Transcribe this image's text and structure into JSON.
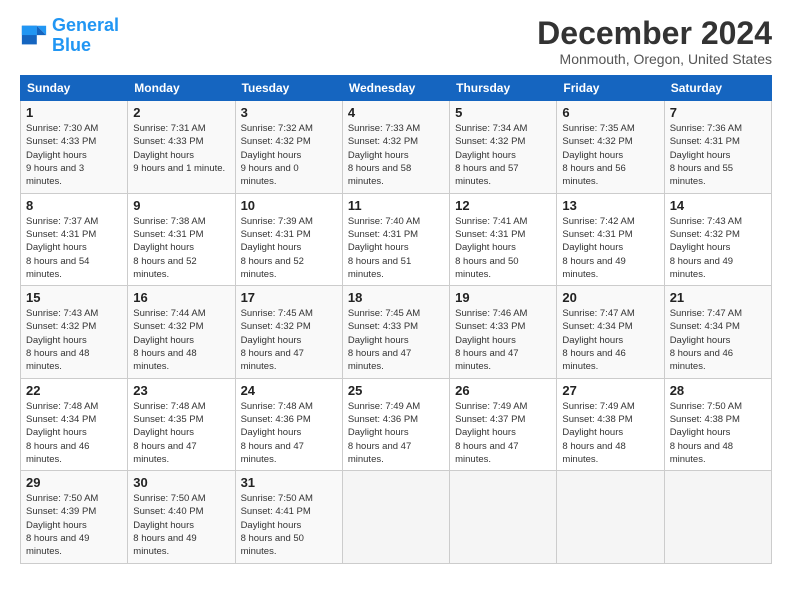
{
  "header": {
    "logo_line1": "General",
    "logo_line2": "Blue",
    "title": "December 2024",
    "subtitle": "Monmouth, Oregon, United States"
  },
  "days_of_week": [
    "Sunday",
    "Monday",
    "Tuesday",
    "Wednesday",
    "Thursday",
    "Friday",
    "Saturday"
  ],
  "weeks": [
    [
      {
        "num": "1",
        "rise": "7:30 AM",
        "set": "4:33 PM",
        "daylight": "9 hours and 3 minutes."
      },
      {
        "num": "2",
        "rise": "7:31 AM",
        "set": "4:33 PM",
        "daylight": "9 hours and 1 minute."
      },
      {
        "num": "3",
        "rise": "7:32 AM",
        "set": "4:32 PM",
        "daylight": "9 hours and 0 minutes."
      },
      {
        "num": "4",
        "rise": "7:33 AM",
        "set": "4:32 PM",
        "daylight": "8 hours and 58 minutes."
      },
      {
        "num": "5",
        "rise": "7:34 AM",
        "set": "4:32 PM",
        "daylight": "8 hours and 57 minutes."
      },
      {
        "num": "6",
        "rise": "7:35 AM",
        "set": "4:32 PM",
        "daylight": "8 hours and 56 minutes."
      },
      {
        "num": "7",
        "rise": "7:36 AM",
        "set": "4:31 PM",
        "daylight": "8 hours and 55 minutes."
      }
    ],
    [
      {
        "num": "8",
        "rise": "7:37 AM",
        "set": "4:31 PM",
        "daylight": "8 hours and 54 minutes."
      },
      {
        "num": "9",
        "rise": "7:38 AM",
        "set": "4:31 PM",
        "daylight": "8 hours and 52 minutes."
      },
      {
        "num": "10",
        "rise": "7:39 AM",
        "set": "4:31 PM",
        "daylight": "8 hours and 52 minutes."
      },
      {
        "num": "11",
        "rise": "7:40 AM",
        "set": "4:31 PM",
        "daylight": "8 hours and 51 minutes."
      },
      {
        "num": "12",
        "rise": "7:41 AM",
        "set": "4:31 PM",
        "daylight": "8 hours and 50 minutes."
      },
      {
        "num": "13",
        "rise": "7:42 AM",
        "set": "4:31 PM",
        "daylight": "8 hours and 49 minutes."
      },
      {
        "num": "14",
        "rise": "7:43 AM",
        "set": "4:32 PM",
        "daylight": "8 hours and 49 minutes."
      }
    ],
    [
      {
        "num": "15",
        "rise": "7:43 AM",
        "set": "4:32 PM",
        "daylight": "8 hours and 48 minutes."
      },
      {
        "num": "16",
        "rise": "7:44 AM",
        "set": "4:32 PM",
        "daylight": "8 hours and 48 minutes."
      },
      {
        "num": "17",
        "rise": "7:45 AM",
        "set": "4:32 PM",
        "daylight": "8 hours and 47 minutes."
      },
      {
        "num": "18",
        "rise": "7:45 AM",
        "set": "4:33 PM",
        "daylight": "8 hours and 47 minutes."
      },
      {
        "num": "19",
        "rise": "7:46 AM",
        "set": "4:33 PM",
        "daylight": "8 hours and 47 minutes."
      },
      {
        "num": "20",
        "rise": "7:47 AM",
        "set": "4:34 PM",
        "daylight": "8 hours and 46 minutes."
      },
      {
        "num": "21",
        "rise": "7:47 AM",
        "set": "4:34 PM",
        "daylight": "8 hours and 46 minutes."
      }
    ],
    [
      {
        "num": "22",
        "rise": "7:48 AM",
        "set": "4:34 PM",
        "daylight": "8 hours and 46 minutes."
      },
      {
        "num": "23",
        "rise": "7:48 AM",
        "set": "4:35 PM",
        "daylight": "8 hours and 47 minutes."
      },
      {
        "num": "24",
        "rise": "7:48 AM",
        "set": "4:36 PM",
        "daylight": "8 hours and 47 minutes."
      },
      {
        "num": "25",
        "rise": "7:49 AM",
        "set": "4:36 PM",
        "daylight": "8 hours and 47 minutes."
      },
      {
        "num": "26",
        "rise": "7:49 AM",
        "set": "4:37 PM",
        "daylight": "8 hours and 47 minutes."
      },
      {
        "num": "27",
        "rise": "7:49 AM",
        "set": "4:38 PM",
        "daylight": "8 hours and 48 minutes."
      },
      {
        "num": "28",
        "rise": "7:50 AM",
        "set": "4:38 PM",
        "daylight": "8 hours and 48 minutes."
      }
    ],
    [
      {
        "num": "29",
        "rise": "7:50 AM",
        "set": "4:39 PM",
        "daylight": "8 hours and 49 minutes."
      },
      {
        "num": "30",
        "rise": "7:50 AM",
        "set": "4:40 PM",
        "daylight": "8 hours and 49 minutes."
      },
      {
        "num": "31",
        "rise": "7:50 AM",
        "set": "4:41 PM",
        "daylight": "8 hours and 50 minutes."
      },
      null,
      null,
      null,
      null
    ]
  ]
}
